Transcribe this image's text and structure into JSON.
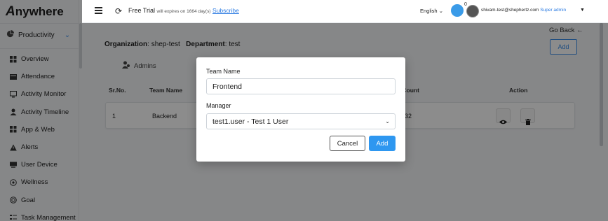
{
  "app": {
    "logo_letter": "A",
    "logo_rest": "nywhere"
  },
  "sidebar": {
    "section_label": "Productivity",
    "items": [
      {
        "label": "Overview",
        "icon": "grid-icon"
      },
      {
        "label": "Attendance",
        "icon": "calendar-icon"
      },
      {
        "label": "Activity Monitor",
        "icon": "monitor-icon"
      },
      {
        "label": "Activity Timeline",
        "icon": "user-timeline-icon"
      },
      {
        "label": "App & Web",
        "icon": "apps-icon"
      },
      {
        "label": "Alerts",
        "icon": "warning-icon"
      },
      {
        "label": "User Device",
        "icon": "device-icon"
      },
      {
        "label": "Wellness",
        "icon": "wellness-icon"
      },
      {
        "label": "Goal",
        "icon": "goal-icon"
      },
      {
        "label": "Task Management",
        "icon": "task-icon"
      }
    ]
  },
  "header": {
    "trial_text": "Free Trial",
    "trial_note": "will expires on 1664 day(s)",
    "subscribe": "Subscribe",
    "language": "English",
    "notification_count": "0",
    "user_email": "shivam-test@shephertz.com",
    "user_role": "Super admin"
  },
  "main": {
    "go_back": "Go Back",
    "add_button": "Add",
    "org_label": "Organization",
    "org_value": "shep-test",
    "dept_label": "Department",
    "dept_value": "test",
    "admins_label": "Admins",
    "table": {
      "headers": [
        "Sr.No.",
        "Team Name",
        "er Count",
        "Action"
      ],
      "rows": [
        {
          "sr": "1",
          "team": "Backend",
          "count": "32"
        }
      ]
    }
  },
  "modal": {
    "team_name_label": "Team Name",
    "team_name_value": "Frontend",
    "manager_label": "Manager",
    "manager_value": "test1.user - Test 1 User",
    "cancel_label": "Cancel",
    "add_label": "Add"
  },
  "colors": {
    "accent": "#2e97f0",
    "link": "#2a7ae2"
  }
}
